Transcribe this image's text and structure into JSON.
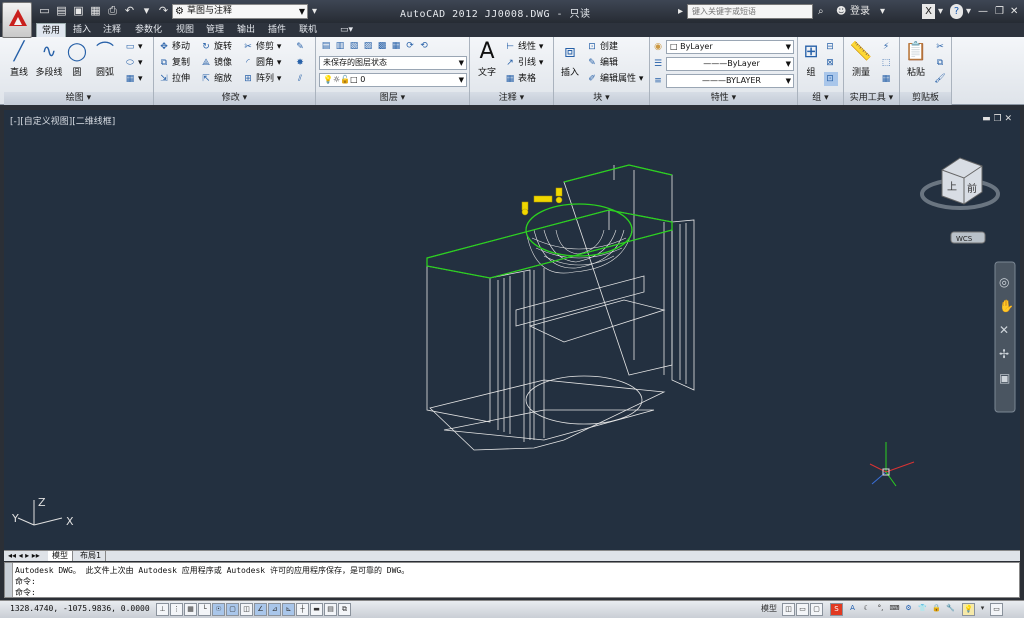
{
  "titlebar": {
    "workspace": "草图与注释",
    "title": "AutoCAD 2012    JJ0008.DWG - 只读",
    "search_placeholder": "键入关键字或短语",
    "login": "登录",
    "help": "?"
  },
  "menubar": {
    "items": [
      "常用",
      "插入",
      "注释",
      "参数化",
      "视图",
      "管理",
      "输出",
      "插件",
      "联机"
    ]
  },
  "ribbon": {
    "draw": {
      "title": "绘图",
      "line": "直线",
      "polyline": "多段线",
      "circle": "圆",
      "arc": "圆弧"
    },
    "modify": {
      "title": "修改",
      "move": "移动",
      "rotate": "旋转",
      "trim": "修剪",
      "copy": "复制",
      "mirror": "镜像",
      "fillet": "圆角",
      "stretch": "拉伸",
      "scale": "缩放",
      "array": "阵列"
    },
    "layers": {
      "title": "图层",
      "state": "未保存的图层状态",
      "current": "0"
    },
    "annotation": {
      "title": "注释",
      "text": "文字",
      "linear": "线性",
      "leader": "引线",
      "table": "表格"
    },
    "block": {
      "title": "块",
      "insert": "插入",
      "create": "创建",
      "edit": "编辑",
      "edit_attr": "编辑属性"
    },
    "properties": {
      "title": "特性",
      "color": "ByLayer",
      "linetype": "ByLayer",
      "lineweight": "BYLAYER"
    },
    "groups": {
      "title": "组",
      "group": "组"
    },
    "utilities": {
      "title": "实用工具",
      "measure": "测量"
    },
    "clipboard": {
      "title": "剪贴板",
      "paste": "粘贴"
    }
  },
  "viewport": {
    "label": "[-][自定义视图][二维线框]",
    "viewcube_top": "上",
    "viewcube_front": "前",
    "wcs": "WCS",
    "axis_x": "X",
    "axis_y": "Y",
    "axis_z": "Z"
  },
  "layouts": {
    "tabs": [
      "模型",
      "布局1"
    ]
  },
  "command": {
    "lines": [
      "Autodesk DWG。   此文件上次由 Autodesk 应用程序或 Autodesk 许可的应用程序保存，是可靠的 DWG。",
      "命令:",
      "命令:"
    ]
  },
  "status": {
    "coords": "1328.4740, -1075.9836, 0.0000",
    "model": "模型"
  },
  "colors": {
    "wire": "#e6e6e6",
    "highlight": "#2bd11f",
    "faucet": "#f0d700",
    "viewport_bg": "#233040"
  }
}
